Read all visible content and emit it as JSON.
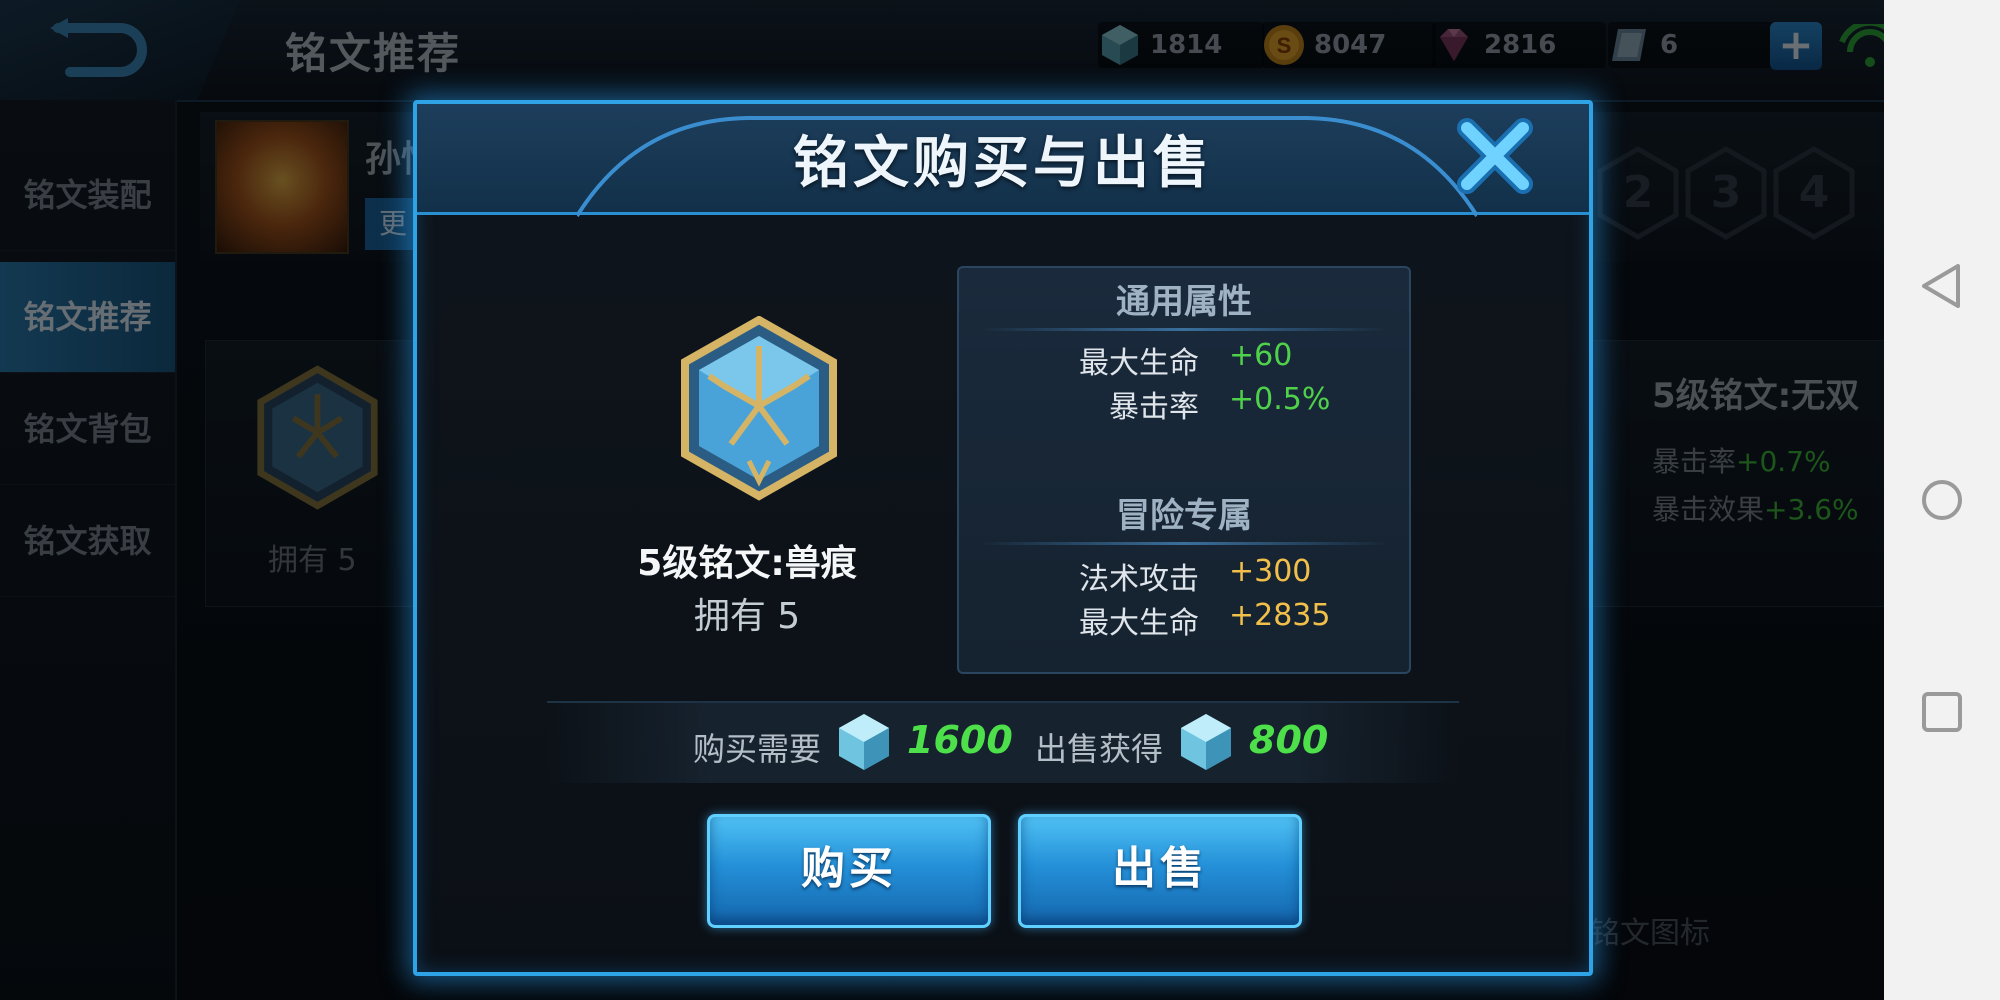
{
  "topbar": {
    "title": "铭文推荐",
    "currencies": [
      {
        "icon": "crystal-icon",
        "value": "1814"
      },
      {
        "icon": "gold-coin-icon",
        "value": "8047"
      },
      {
        "icon": "diamond-icon",
        "value": "2816"
      },
      {
        "icon": "voucher-icon",
        "value": "6"
      }
    ],
    "plus": "+"
  },
  "sidebar": {
    "items": [
      {
        "label": "铭文装配",
        "active": false
      },
      {
        "label": "铭文推荐",
        "active": true
      },
      {
        "label": "铭文背包",
        "active": false
      },
      {
        "label": "铭文获取",
        "active": false
      }
    ]
  },
  "background": {
    "hero_name": "孙悟",
    "hero_change": "更",
    "slots": [
      "2",
      "3",
      "4"
    ],
    "rune_owned": "拥有 5",
    "detail_title": "5级铭文:无双",
    "detail_stats": [
      {
        "label": "暴击率",
        "value": "+0.7%"
      },
      {
        "label": "暴击效果",
        "value": "+3.6%"
      }
    ],
    "bottom_note": "铭文图标"
  },
  "modal": {
    "title": "铭文购买与出售",
    "rune_name": "5级铭文:兽痕",
    "rune_owned": "拥有 5",
    "general": {
      "heading": "通用属性",
      "stats": [
        {
          "label": "最大生命",
          "value": "+60"
        },
        {
          "label": "暴击率",
          "value": "+0.5%"
        }
      ]
    },
    "adventure": {
      "heading": "冒险专属",
      "stats": [
        {
          "label": "法术攻击",
          "value": "+300"
        },
        {
          "label": "最大生命",
          "value": "+2835"
        }
      ]
    },
    "buy_label": "购买需要",
    "buy_price": "1600",
    "sell_label": "出售获得",
    "sell_price": "800",
    "buy_button": "购买",
    "sell_button": "出售"
  },
  "colors": {
    "accent": "#2ea4e6",
    "stat_green": "#4fd24a",
    "stat_gold": "#f2c04a"
  }
}
